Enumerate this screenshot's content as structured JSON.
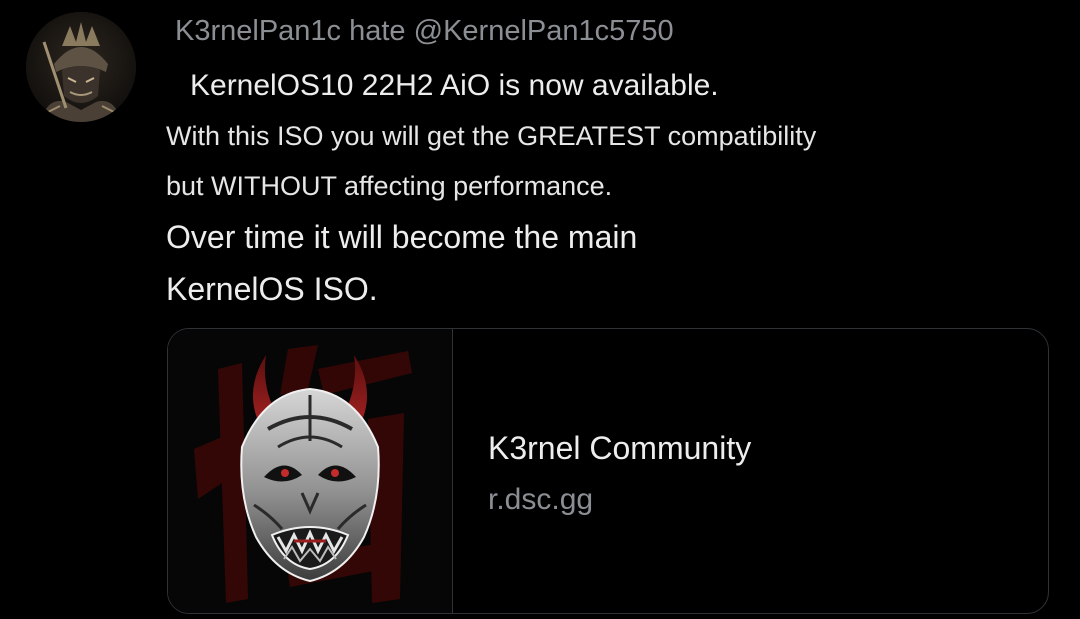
{
  "tweet": {
    "author": {
      "display_name": "K3rnelPan1c hate",
      "handle": "@KernelPan1c5750",
      "avatar_icon": "samurai-avatar"
    },
    "text": {
      "headline": "KernelOS10 22H2 AiO is now available.",
      "line2": "With this ISO you will get the GREATEST compatibility",
      "line3": "but WITHOUT affecting performance.",
      "line4": "Over time it will become the main",
      "line5": "KernelOS ISO."
    },
    "link_card": {
      "title": "K3rnel Community",
      "domain": "r.dsc.gg",
      "image_icon": "oni-mask-logo"
    }
  },
  "colors": {
    "background": "#000000",
    "text_primary": "#ededed",
    "text_secondary": "#8b8f94",
    "card_border": "#2f3336",
    "accent_red": "#8b1414"
  }
}
